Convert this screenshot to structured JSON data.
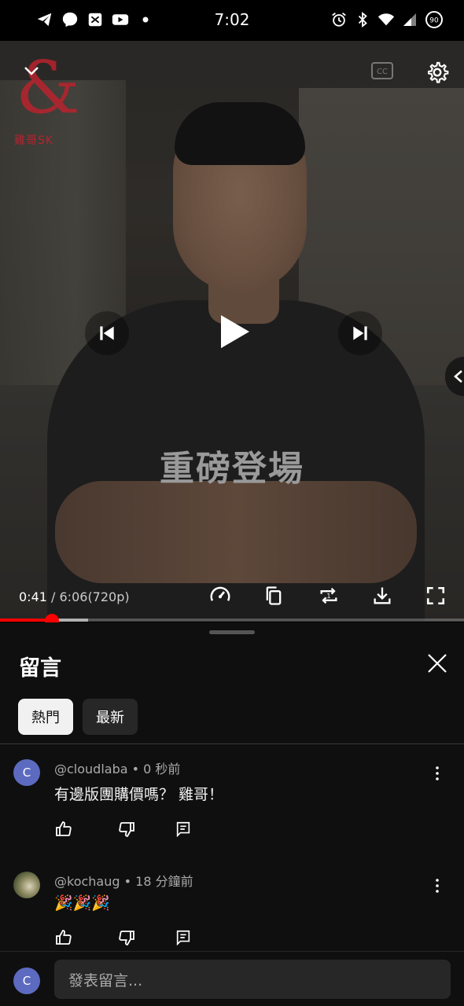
{
  "status_bar": {
    "time": "7:02",
    "left_icons": [
      "telegram-icon",
      "messenger-icon",
      "app-icon",
      "youtube-icon",
      "dot-icon"
    ],
    "right_icons": [
      "alarm-icon",
      "bluetooth-icon",
      "wifi-icon",
      "signal-icon",
      "battery-icon"
    ],
    "battery_level": "90"
  },
  "video": {
    "watermark_text": "雞哥SK",
    "caption": "重磅登場",
    "current_time": "0:41",
    "separator": " / ",
    "duration": "6:06",
    "quality": "(720p)",
    "progress_fraction": 0.112,
    "buffer_fraction": 0.19,
    "icons": {
      "collapse": "chevron-down-icon",
      "cc": "closed-captions-icon",
      "settings": "gear-icon",
      "prev": "skip-previous-icon",
      "play": "play-icon",
      "next": "skip-next-icon",
      "speed": "playback-speed-icon",
      "copy": "copy-icon",
      "loop": "loop-one-icon",
      "download": "download-icon",
      "fullscreen": "fullscreen-icon"
    }
  },
  "comments_panel": {
    "title": "留言",
    "tabs": [
      {
        "label": "熱門",
        "active": true
      },
      {
        "label": "最新",
        "active": false
      }
    ],
    "comments": [
      {
        "avatar_letter": "C",
        "author": "@cloudlaba",
        "time": "0 秒前",
        "text": "有邊版團購價嗎？ 雞哥！"
      },
      {
        "avatar_letter": "",
        "author": "@kochaug",
        "time": "18 分鐘前",
        "text": "🎉🎉🎉"
      }
    ],
    "compose": {
      "avatar_letter": "C",
      "placeholder": "發表留言..."
    }
  },
  "colors": {
    "accent_red": "#ff0000",
    "avatar_blue": "#5c6bc0",
    "panel_bg": "#0f0f0f"
  }
}
